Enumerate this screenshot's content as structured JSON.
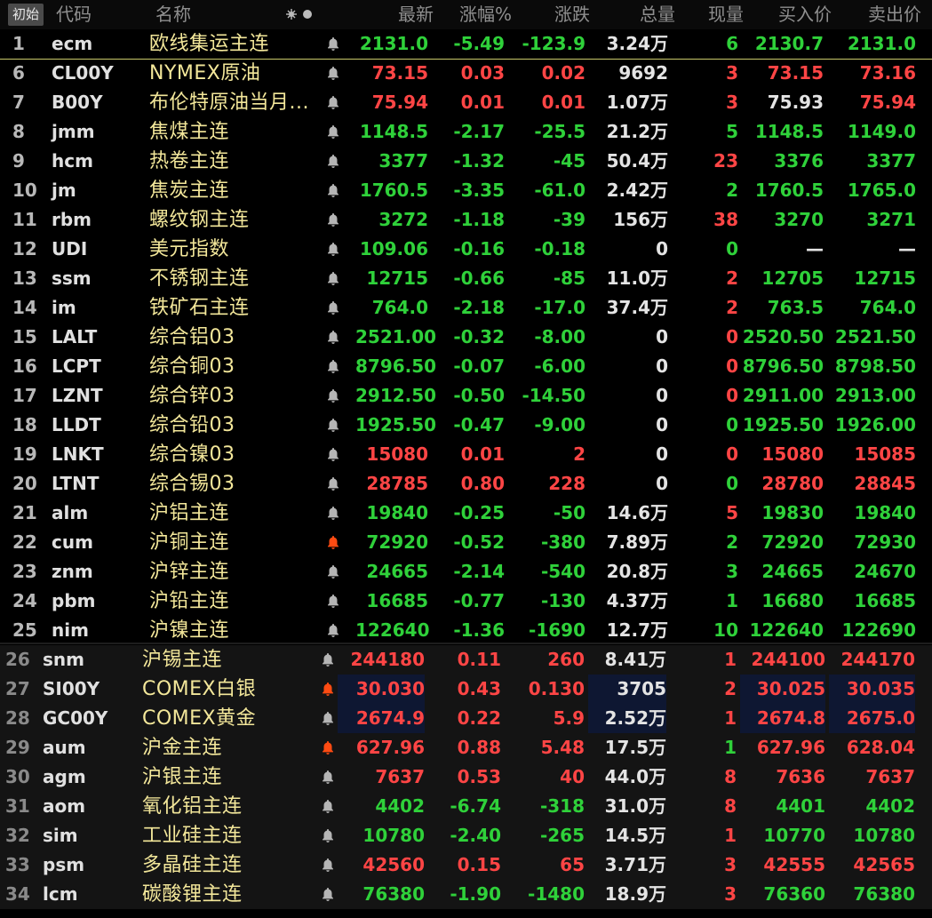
{
  "header": {
    "first_btn": "初始",
    "code": "代码",
    "name": "名称",
    "latest": "最新",
    "change_pct": "涨幅%",
    "change": "涨跌",
    "volume": "总量",
    "cur_vol": "现量",
    "bid": "买入价",
    "ask": "卖出价"
  },
  "colors": {
    "up": "#ff4545",
    "down": "#2fd13a",
    "name": "#f3e79a",
    "bell_alert": "#ff4b12"
  },
  "rows": [
    {
      "idx": "1",
      "code": "ecm",
      "name": "欧线集运主连",
      "bell": "normal",
      "latest": "2131.0",
      "pct": "-5.49",
      "chg": "-123.9",
      "vol": "3.24万",
      "cur": "6",
      "bid": "2130.7",
      "ask": "2131.0",
      "c": [
        "down",
        "down",
        "down",
        "neu",
        "down",
        "down",
        "down"
      ]
    },
    {
      "idx": "6",
      "code": "CL00Y",
      "name": "NYMEX原油",
      "bell": "normal",
      "latest": "73.15",
      "pct": "0.03",
      "chg": "0.02",
      "vol": "9692",
      "cur": "3",
      "bid": "73.15",
      "ask": "73.16",
      "c": [
        "up",
        "up",
        "up",
        "neu",
        "up",
        "up",
        "up"
      ]
    },
    {
      "idx": "7",
      "code": "B00Y",
      "name": "布伦特原油当月...",
      "bell": "normal",
      "latest": "75.94",
      "pct": "0.01",
      "chg": "0.01",
      "vol": "1.07万",
      "cur": "3",
      "bid": "75.93",
      "ask": "75.94",
      "c": [
        "up",
        "up",
        "up",
        "neu",
        "up",
        "neu",
        "up"
      ]
    },
    {
      "idx": "8",
      "code": "jmm",
      "name": "焦煤主连",
      "bell": "normal",
      "latest": "1148.5",
      "pct": "-2.17",
      "chg": "-25.5",
      "vol": "21.2万",
      "cur": "5",
      "bid": "1148.5",
      "ask": "1149.0",
      "c": [
        "down",
        "down",
        "down",
        "neu",
        "down",
        "down",
        "down"
      ]
    },
    {
      "idx": "9",
      "code": "hcm",
      "name": "热卷主连",
      "bell": "normal",
      "latest": "3377",
      "pct": "-1.32",
      "chg": "-45",
      "vol": "50.4万",
      "cur": "23",
      "bid": "3376",
      "ask": "3377",
      "c": [
        "down",
        "down",
        "down",
        "neu",
        "up",
        "down",
        "down"
      ]
    },
    {
      "idx": "10",
      "code": "jm",
      "name": "焦炭主连",
      "bell": "normal",
      "latest": "1760.5",
      "pct": "-3.35",
      "chg": "-61.0",
      "vol": "2.42万",
      "cur": "2",
      "bid": "1760.5",
      "ask": "1765.0",
      "c": [
        "down",
        "down",
        "down",
        "neu",
        "down",
        "down",
        "down"
      ]
    },
    {
      "idx": "11",
      "code": "rbm",
      "name": "螺纹钢主连",
      "bell": "normal",
      "latest": "3272",
      "pct": "-1.18",
      "chg": "-39",
      "vol": "156万",
      "cur": "38",
      "bid": "3270",
      "ask": "3271",
      "c": [
        "down",
        "down",
        "down",
        "neu",
        "up",
        "down",
        "down"
      ]
    },
    {
      "idx": "12",
      "code": "UDI",
      "name": "美元指数",
      "bell": "normal",
      "latest": "109.06",
      "pct": "-0.16",
      "chg": "-0.18",
      "vol": "0",
      "cur": "0",
      "bid": "—",
      "ask": "—",
      "c": [
        "down",
        "down",
        "down",
        "neu",
        "down",
        "neu",
        "neu"
      ]
    },
    {
      "idx": "13",
      "code": "ssm",
      "name": "不锈钢主连",
      "bell": "normal",
      "latest": "12715",
      "pct": "-0.66",
      "chg": "-85",
      "vol": "11.0万",
      "cur": "2",
      "bid": "12705",
      "ask": "12715",
      "c": [
        "down",
        "down",
        "down",
        "neu",
        "up",
        "down",
        "down"
      ]
    },
    {
      "idx": "14",
      "code": "im",
      "name": "铁矿石主连",
      "bell": "normal",
      "latest": "764.0",
      "pct": "-2.18",
      "chg": "-17.0",
      "vol": "37.4万",
      "cur": "2",
      "bid": "763.5",
      "ask": "764.0",
      "c": [
        "down",
        "down",
        "down",
        "neu",
        "up",
        "down",
        "down"
      ]
    },
    {
      "idx": "15",
      "code": "LALT",
      "name": "综合铝03",
      "bell": "normal",
      "latest": "2521.00",
      "pct": "-0.32",
      "chg": "-8.00",
      "vol": "0",
      "cur": "0",
      "bid": "2520.50",
      "ask": "2521.50",
      "c": [
        "down",
        "down",
        "down",
        "neu",
        "up",
        "down",
        "down"
      ]
    },
    {
      "idx": "16",
      "code": "LCPT",
      "name": "综合铜03",
      "bell": "normal",
      "latest": "8796.50",
      "pct": "-0.07",
      "chg": "-6.00",
      "vol": "0",
      "cur": "0",
      "bid": "8796.50",
      "ask": "8798.50",
      "c": [
        "down",
        "down",
        "down",
        "neu",
        "up",
        "down",
        "down"
      ]
    },
    {
      "idx": "17",
      "code": "LZNT",
      "name": "综合锌03",
      "bell": "normal",
      "latest": "2912.50",
      "pct": "-0.50",
      "chg": "-14.50",
      "vol": "0",
      "cur": "0",
      "bid": "2911.00",
      "ask": "2913.00",
      "c": [
        "down",
        "down",
        "down",
        "neu",
        "up",
        "down",
        "down"
      ]
    },
    {
      "idx": "18",
      "code": "LLDT",
      "name": "综合铅03",
      "bell": "normal",
      "latest": "1925.50",
      "pct": "-0.47",
      "chg": "-9.00",
      "vol": "0",
      "cur": "0",
      "bid": "1925.50",
      "ask": "1926.00",
      "c": [
        "down",
        "down",
        "down",
        "neu",
        "down",
        "down",
        "down"
      ]
    },
    {
      "idx": "19",
      "code": "LNKT",
      "name": "综合镍03",
      "bell": "normal",
      "latest": "15080",
      "pct": "0.01",
      "chg": "2",
      "vol": "0",
      "cur": "0",
      "bid": "15080",
      "ask": "15085",
      "c": [
        "up",
        "up",
        "up",
        "neu",
        "up",
        "up",
        "up"
      ]
    },
    {
      "idx": "20",
      "code": "LTNT",
      "name": "综合锡03",
      "bell": "normal",
      "latest": "28785",
      "pct": "0.80",
      "chg": "228",
      "vol": "0",
      "cur": "0",
      "bid": "28780",
      "ask": "28845",
      "c": [
        "up",
        "up",
        "up",
        "neu",
        "down",
        "up",
        "up"
      ]
    },
    {
      "idx": "21",
      "code": "alm",
      "name": "沪铝主连",
      "bell": "normal",
      "latest": "19840",
      "pct": "-0.25",
      "chg": "-50",
      "vol": "14.6万",
      "cur": "5",
      "bid": "19830",
      "ask": "19840",
      "c": [
        "down",
        "down",
        "down",
        "neu",
        "up",
        "down",
        "down"
      ]
    },
    {
      "idx": "22",
      "code": "cum",
      "name": "沪铜主连",
      "bell": "alert",
      "latest": "72920",
      "pct": "-0.52",
      "chg": "-380",
      "vol": "7.89万",
      "cur": "2",
      "bid": "72920",
      "ask": "72930",
      "c": [
        "down",
        "down",
        "down",
        "neu",
        "down",
        "down",
        "down"
      ]
    },
    {
      "idx": "23",
      "code": "znm",
      "name": "沪锌主连",
      "bell": "normal",
      "latest": "24665",
      "pct": "-2.14",
      "chg": "-540",
      "vol": "20.8万",
      "cur": "3",
      "bid": "24665",
      "ask": "24670",
      "c": [
        "down",
        "down",
        "down",
        "neu",
        "down",
        "down",
        "down"
      ]
    },
    {
      "idx": "24",
      "code": "pbm",
      "name": "沪铅主连",
      "bell": "normal",
      "latest": "16685",
      "pct": "-0.77",
      "chg": "-130",
      "vol": "4.37万",
      "cur": "1",
      "bid": "16680",
      "ask": "16685",
      "c": [
        "down",
        "down",
        "down",
        "neu",
        "down",
        "down",
        "down"
      ]
    },
    {
      "idx": "25",
      "code": "nim",
      "name": "沪镍主连",
      "bell": "normal",
      "latest": "122640",
      "pct": "-1.36",
      "chg": "-1690",
      "vol": "12.7万",
      "cur": "10",
      "bid": "122640",
      "ask": "122690",
      "c": [
        "down",
        "down",
        "down",
        "neu",
        "down",
        "down",
        "down"
      ]
    },
    {
      "idx": "26",
      "code": "snm",
      "name": "沪锡主连",
      "bell": "normal",
      "latest": "244180",
      "pct": "0.11",
      "chg": "260",
      "vol": "8.41万",
      "cur": "1",
      "bid": "244100",
      "ask": "244170",
      "c": [
        "up",
        "up",
        "up",
        "neu",
        "up",
        "up",
        "up"
      ]
    },
    {
      "idx": "27",
      "code": "SI00Y",
      "name": "COMEX白银",
      "bell": "alert",
      "latest": "30.030",
      "pct": "0.43",
      "chg": "0.130",
      "vol": "3705",
      "cur": "2",
      "bid": "30.025",
      "ask": "30.035",
      "c": [
        "up",
        "up",
        "up",
        "neu",
        "up",
        "up",
        "up"
      ]
    },
    {
      "idx": "28",
      "code": "GC00Y",
      "name": "COMEX黄金",
      "bell": "normal",
      "latest": "2674.9",
      "pct": "0.22",
      "chg": "5.9",
      "vol": "2.52万",
      "cur": "1",
      "bid": "2674.8",
      "ask": "2675.0",
      "c": [
        "up",
        "up",
        "up",
        "neu",
        "up",
        "up",
        "up"
      ]
    },
    {
      "idx": "29",
      "code": "aum",
      "name": "沪金主连",
      "bell": "alert",
      "latest": "627.96",
      "pct": "0.88",
      "chg": "5.48",
      "vol": "17.5万",
      "cur": "1",
      "bid": "627.96",
      "ask": "628.04",
      "c": [
        "up",
        "up",
        "up",
        "neu",
        "down",
        "up",
        "up"
      ]
    },
    {
      "idx": "30",
      "code": "agm",
      "name": "沪银主连",
      "bell": "normal",
      "latest": "7637",
      "pct": "0.53",
      "chg": "40",
      "vol": "44.0万",
      "cur": "8",
      "bid": "7636",
      "ask": "7637",
      "c": [
        "up",
        "up",
        "up",
        "neu",
        "up",
        "up",
        "up"
      ]
    },
    {
      "idx": "31",
      "code": "aom",
      "name": "氧化铝主连",
      "bell": "normal",
      "latest": "4402",
      "pct": "-6.74",
      "chg": "-318",
      "vol": "31.0万",
      "cur": "8",
      "bid": "4401",
      "ask": "4402",
      "c": [
        "down",
        "down",
        "down",
        "neu",
        "up",
        "down",
        "down"
      ]
    },
    {
      "idx": "32",
      "code": "sim",
      "name": "工业硅主连",
      "bell": "normal",
      "latest": "10780",
      "pct": "-2.40",
      "chg": "-265",
      "vol": "14.5万",
      "cur": "1",
      "bid": "10770",
      "ask": "10780",
      "c": [
        "down",
        "down",
        "down",
        "neu",
        "up",
        "down",
        "down"
      ]
    },
    {
      "idx": "33",
      "code": "psm",
      "name": "多晶硅主连",
      "bell": "normal",
      "latest": "42560",
      "pct": "0.15",
      "chg": "65",
      "vol": "3.71万",
      "cur": "3",
      "bid": "42555",
      "ask": "42565",
      "c": [
        "up",
        "up",
        "up",
        "neu",
        "up",
        "up",
        "up"
      ]
    },
    {
      "idx": "34",
      "code": "lcm",
      "name": "碳酸锂主连",
      "bell": "normal",
      "latest": "76380",
      "pct": "-1.90",
      "chg": "-1480",
      "vol": "18.9万",
      "cur": "3",
      "bid": "76360",
      "ask": "76380",
      "c": [
        "down",
        "down",
        "down",
        "neu",
        "up",
        "down",
        "down"
      ]
    }
  ]
}
